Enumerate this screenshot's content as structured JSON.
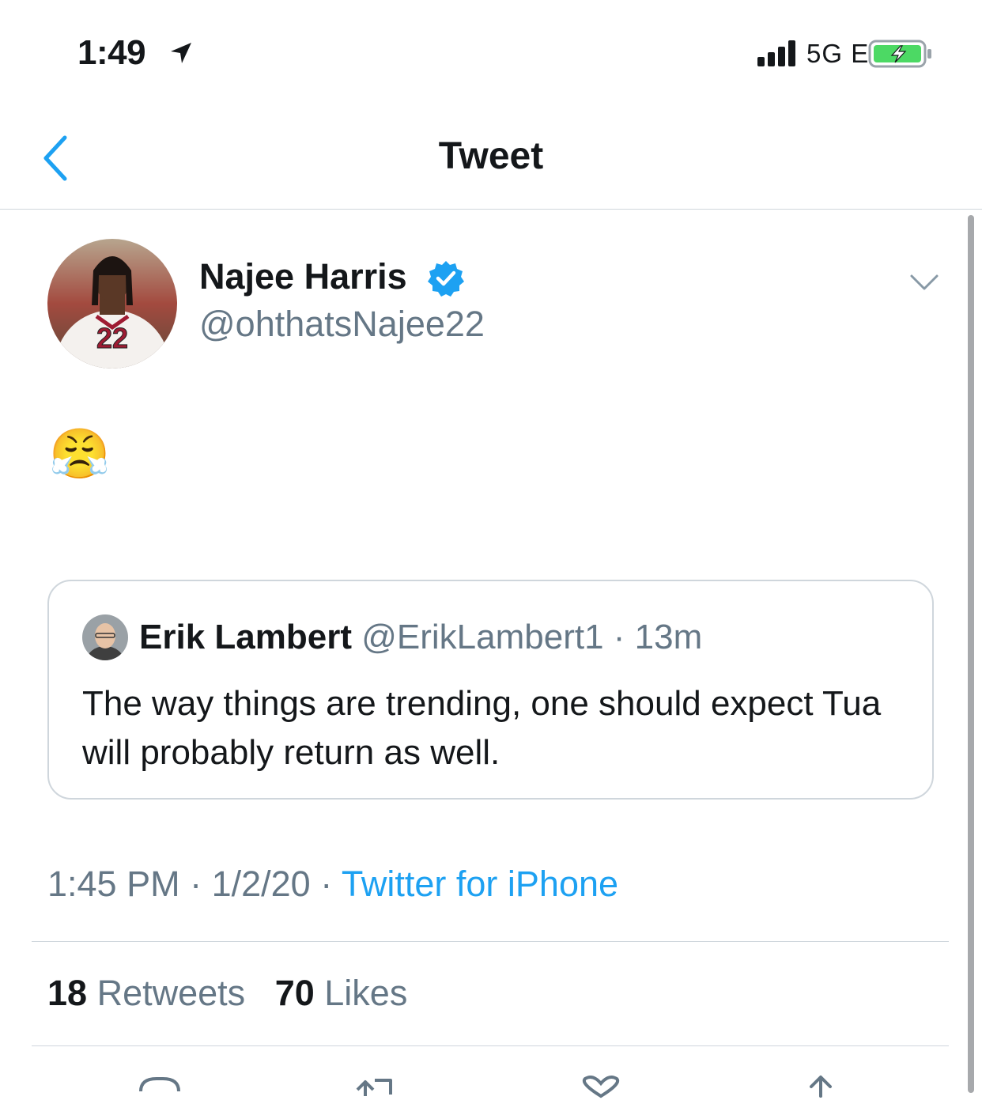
{
  "status_bar": {
    "time": "1:49",
    "network": "5G E"
  },
  "nav": {
    "title": "Tweet"
  },
  "tweet": {
    "author_name": "Najee Harris",
    "author_handle": "@ohthatsNajee22",
    "jersey_number": "22",
    "body": "😤",
    "timestamp": "1:45 PM · 1/2/20 · ",
    "source": "Twitter for iPhone"
  },
  "quoted_tweet": {
    "author_name": "Erik Lambert",
    "meta": "@ErikLambert1 · 13m",
    "text": "The way things are trending, one should expect Tua will probably return as well."
  },
  "stats": {
    "retweets_count": "18",
    "retweets_label": "Retweets",
    "likes_count": "70",
    "likes_label": "Likes"
  },
  "colors": {
    "accent": "#1da1f2",
    "secondary_text": "#657786",
    "divider": "#cfd6dc",
    "jersey": "#9e1b32"
  }
}
